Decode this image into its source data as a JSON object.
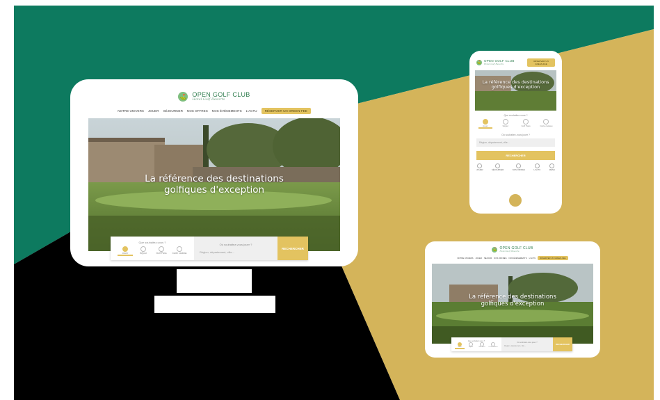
{
  "colors": {
    "green": "#0d7a5f",
    "gold": "#d4b45a",
    "black": "#000000",
    "accent": "#e3c360",
    "brand_text": "#2f7d4e"
  },
  "brand": {
    "name": "OPEN GOLF CLUB",
    "tagline": "Hotel Golf Resorts",
    "icon": "golf-ball-icon"
  },
  "desktop": {
    "nav": [
      "NOTRE UNIVERS",
      "JOUER",
      "SÉJOURNER",
      "NOS OFFRES",
      "NOS ÉVÉNEMENTS",
      "L'ACTU"
    ],
    "nav_cta": "RÉSERVER UN GREEN-FEE",
    "hero_title_1": "La référence des destinations",
    "hero_title_2": "golfiques d'exception",
    "search": {
      "question": "Que souhaitez-vous ?",
      "chips": [
        "Jouer",
        "Séjour",
        "Golf Pass",
        "Carte cadeau"
      ],
      "where_label": "Où souhaitez-vous jouer ?",
      "where_placeholder": "Région, département, ville...",
      "button": "RECHERCHER"
    }
  },
  "mobile": {
    "cta": "RÉSERVER UN GREEN-FEE",
    "hero_title": "La référence des destinations golfiques d'exception",
    "question": "Que souhaitez-vous ?",
    "chips": [
      "Jouer",
      "Séjour",
      "Golf Pass",
      "Carte cadeau"
    ],
    "where_label": "Où souhaitez-vous jouer ?",
    "where_placeholder": "Région, département, ville...",
    "button": "RECHERCHER",
    "bottom_nav": [
      "JOUER",
      "SÉJOURNER",
      "NOS OFFRES",
      "L'ACTU",
      "MENU"
    ]
  },
  "tablet": {
    "nav": [
      "NOTRE UNIVERS",
      "JOUER",
      "SÉJOUR",
      "NOS OFFRES",
      "NOS ÉVÉNEMENTS",
      "L'ACTU"
    ],
    "nav_cta": "RÉSERVER UN GREEN-FEE",
    "hero_title_1": "La référence des destinations",
    "hero_title_2": "golfiques d'exception",
    "question": "Que souhaitez-vous ?",
    "chips": [
      "Jouer",
      "Séjour",
      "Golf Pass",
      "Carte cadeau"
    ],
    "where_label": "Où souhaitez-vous jouer ?",
    "where_placeholder": "Région, département, ville...",
    "button": "RECHERCHER"
  }
}
